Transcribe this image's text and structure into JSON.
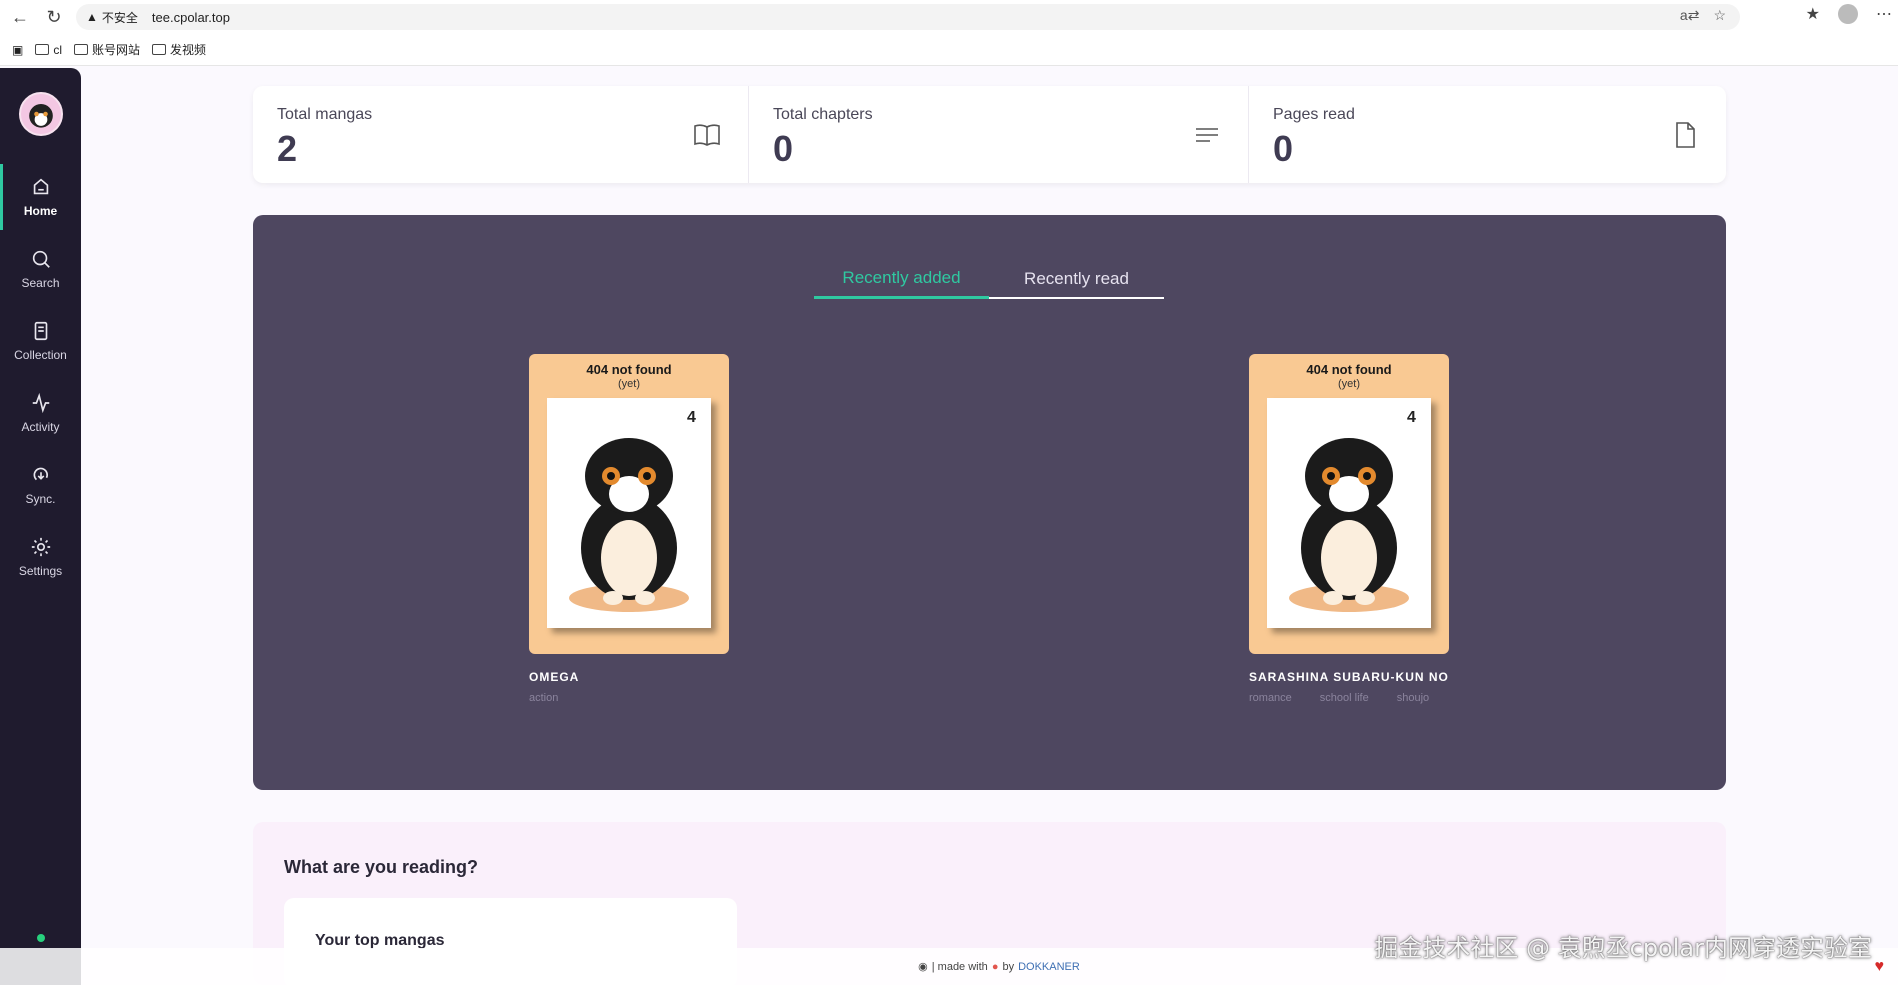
{
  "browser": {
    "security_label": "不安全",
    "url": "tee.cpolar.top",
    "bookmarks": [
      "cl",
      "账号网站",
      "发视频"
    ]
  },
  "sidebar": {
    "items": [
      {
        "label": "Home",
        "icon": "home-icon",
        "active": true
      },
      {
        "label": "Search",
        "icon": "search-icon"
      },
      {
        "label": "Collection",
        "icon": "collection-icon"
      },
      {
        "label": "Activity",
        "icon": "activity-icon"
      },
      {
        "label": "Sync.",
        "icon": "sync-icon"
      },
      {
        "label": "Settings",
        "icon": "gear-icon"
      }
    ]
  },
  "stats": [
    {
      "label": "Total mangas",
      "value": "2",
      "icon": "book-open-icon"
    },
    {
      "label": "Total chapters",
      "value": "0",
      "icon": "lines-icon"
    },
    {
      "label": "Pages read",
      "value": "0",
      "icon": "file-icon"
    }
  ],
  "recent": {
    "tabs": [
      "Recently added",
      "Recently read"
    ],
    "active_tab": "Recently added",
    "cards": [
      {
        "not_found": "404 not found",
        "not_found_sub": "(yet)",
        "title": "OMEGA",
        "genres": [
          "action"
        ]
      },
      {
        "not_found": "404 not found",
        "not_found_sub": "(yet)",
        "title": "SARASHINA SUBARU-KUN NO",
        "genres": [
          "romance",
          "school life",
          "shoujo"
        ]
      }
    ]
  },
  "reading": {
    "heading": "What are you reading?",
    "top_card_title": "Your top mangas"
  },
  "footer": {
    "made_with": "| made with",
    "by": "by",
    "author": "DOKKANER"
  },
  "watermark": "掘金技术社区 @ 袁煦丞cpolar内网穿透实验室",
  "colors": {
    "accent": "#2fc9a1",
    "sidebar_bg": "#1f1b2e",
    "panel_bg": "#4e4760",
    "cover_bg": "#f9c993"
  }
}
